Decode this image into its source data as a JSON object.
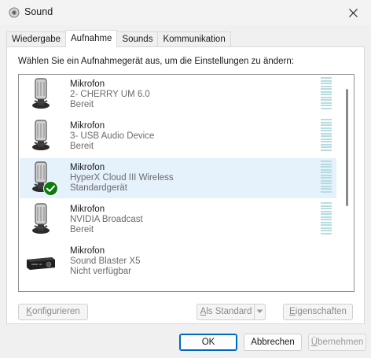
{
  "window": {
    "title": "Sound",
    "icon": "speaker-icon",
    "close_icon": "close-icon"
  },
  "tabs": [
    {
      "label": "Wiedergabe",
      "active": false
    },
    {
      "label": "Aufnahme",
      "active": true
    },
    {
      "label": "Sounds",
      "active": false
    },
    {
      "label": "Kommunikation",
      "active": false
    }
  ],
  "panel": {
    "instruction": "Wählen Sie ein Aufnahmegerät aus, um die Einstellungen zu ändern:"
  },
  "devices": [
    {
      "name": "Mikrofon",
      "description": "2- CHERRY UM 6.0",
      "status": "Bereit",
      "icon": "microphone-icon",
      "selected": false,
      "default": false
    },
    {
      "name": "Mikrofon",
      "description": "3- USB Audio Device",
      "status": "Bereit",
      "icon": "microphone-icon",
      "selected": false,
      "default": false
    },
    {
      "name": "Mikrofon",
      "description": "HyperX Cloud III Wireless",
      "status": "Standardgerät",
      "icon": "microphone-icon",
      "selected": true,
      "default": true
    },
    {
      "name": "Mikrofon",
      "description": "NVIDIA Broadcast",
      "status": "Bereit",
      "icon": "microphone-icon",
      "selected": false,
      "default": false
    },
    {
      "name": "Mikrofon",
      "description": "Sound Blaster X5",
      "status": "Nicht verfügbar",
      "icon": "sound-device-icon",
      "selected": false,
      "default": false
    }
  ],
  "buttons": {
    "configure": {
      "prefix": "",
      "mnemonic": "K",
      "rest": "onfigurieren"
    },
    "set_default": {
      "prefix": "",
      "mnemonic": "A",
      "rest": "ls Standard"
    },
    "properties": {
      "prefix": "",
      "mnemonic": "E",
      "rest": "igenschaften"
    },
    "ok": "OK",
    "cancel": "Abbrechen",
    "apply": {
      "prefix": "",
      "mnemonic": "Ü",
      "rest": "bernehmen"
    }
  },
  "colors": {
    "selection": "#e5f1fb",
    "accent": "#0067c0",
    "default_check": "#0f7b0f",
    "meter": "#b6dce2"
  }
}
